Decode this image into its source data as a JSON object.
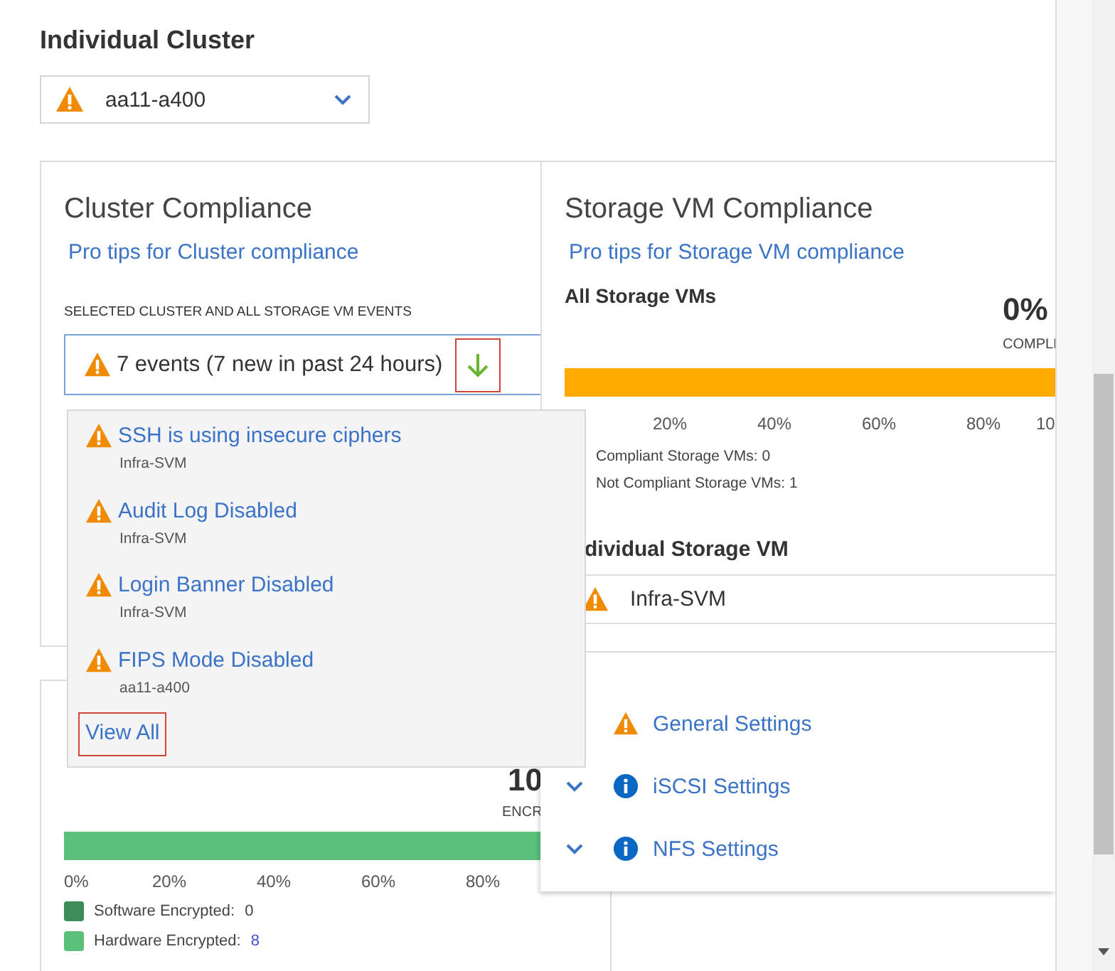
{
  "heading": "Individual Cluster",
  "cluster_select": {
    "value": "aa11-a400"
  },
  "cluster_compliance": {
    "title": "Cluster Compliance",
    "tips_link": "Pro tips for Cluster compliance",
    "events_label": "SELECTED CLUSTER AND ALL STORAGE VM EVENTS",
    "events_summary": "7 events (7 new in past 24 hours)",
    "expand_highlighted": true
  },
  "event_dropdown": {
    "expanded": true,
    "items": [
      {
        "title": "SSH is using insecure ciphers",
        "source": "Infra-SVM"
      },
      {
        "title": "Audit Log Disabled",
        "source": "Infra-SVM"
      },
      {
        "title": "Login Banner Disabled",
        "source": "Infra-SVM"
      },
      {
        "title": "FIPS Mode Disabled",
        "source": "aa11-a400"
      }
    ],
    "view_all": "View All",
    "view_all_highlighted": true
  },
  "storage_vm_compliance": {
    "title": "Storage VM Compliance",
    "tips_link": "Pro tips for Storage VM compliance",
    "subtitle": "All Storage VMs",
    "percent": "0%",
    "percent_label": "COMPLI",
    "bar": {
      "level": 1
    },
    "ticks": [
      "20%",
      "40%",
      "60%",
      "80%",
      "10"
    ],
    "legend": [
      "Compliant Storage VMs: 0",
      "Not Compliant Storage VMs: 1"
    ],
    "individual_heading": "dividual Storage VM",
    "svm_select": {
      "value": "Infra-SVM"
    }
  },
  "settings": [
    {
      "label": "General Settings",
      "kind": "warning",
      "chevron": false
    },
    {
      "label": "iSCSI Settings",
      "kind": "info",
      "chevron": true
    },
    {
      "label": "NFS Settings",
      "kind": "info",
      "chevron": true
    }
  ],
  "encryption": {
    "percent": "10",
    "percent_label": "ENCR",
    "bar": {
      "level": 1
    },
    "ticks": [
      "0%",
      "20%",
      "40%",
      "60%",
      "80%"
    ],
    "legend": [
      {
        "label": "Software Encrypted:",
        "count": "0",
        "count_link": false,
        "color": "#3c8c5a"
      },
      {
        "label": "Hardware Encrypted:",
        "count": "8",
        "count_link": true,
        "color": "#5ac07a"
      }
    ]
  }
}
